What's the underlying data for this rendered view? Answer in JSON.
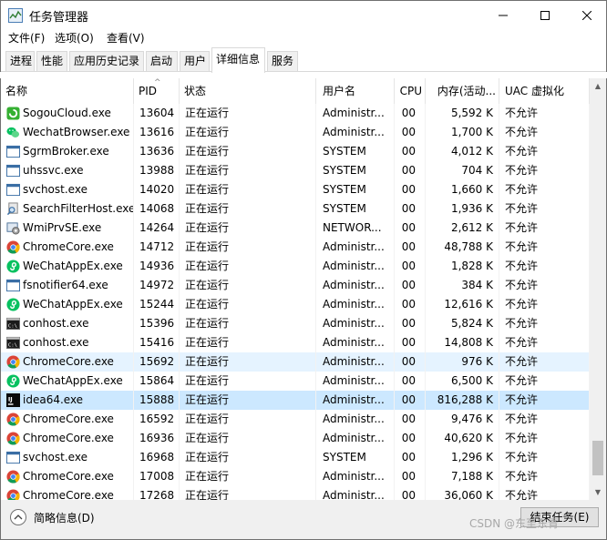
{
  "window": {
    "title": "任务管理器"
  },
  "menu": [
    "文件(F)",
    "选项(O)",
    "查看(V)"
  ],
  "tabs": [
    "进程",
    "性能",
    "应用历史记录",
    "启动",
    "用户",
    "详细信息",
    "服务"
  ],
  "active_tab": "详细信息",
  "columns": {
    "name": "名称",
    "pid": "PID",
    "status": "状态",
    "user": "用户名",
    "cpu": "CPU",
    "memory": "内存(活动...",
    "uac": "UAC 虚拟化"
  },
  "rows": [
    {
      "name": "SogouCloud.exe",
      "pid": "13604",
      "status": "正在运行",
      "user": "Administr...",
      "cpu": "00",
      "mem": "5,592 K",
      "uac": "不允许",
      "icon": "sogou-icon"
    },
    {
      "name": "WechatBrowser.exe",
      "pid": "13616",
      "status": "正在运行",
      "user": "Administr...",
      "cpu": "00",
      "mem": "1,700 K",
      "uac": "不允许",
      "icon": "wechat-icon"
    },
    {
      "name": "SgrmBroker.exe",
      "pid": "13636",
      "status": "正在运行",
      "user": "SYSTEM",
      "cpu": "00",
      "mem": "4,012 K",
      "uac": "不允许",
      "icon": "window-app-icon"
    },
    {
      "name": "uhssvc.exe",
      "pid": "13988",
      "status": "正在运行",
      "user": "SYSTEM",
      "cpu": "00",
      "mem": "704 K",
      "uac": "不允许",
      "icon": "window-app-icon"
    },
    {
      "name": "svchost.exe",
      "pid": "14020",
      "status": "正在运行",
      "user": "SYSTEM",
      "cpu": "00",
      "mem": "1,660 K",
      "uac": "不允许",
      "icon": "window-app-icon"
    },
    {
      "name": "SearchFilterHost.exe",
      "pid": "14068",
      "status": "正在运行",
      "user": "SYSTEM",
      "cpu": "00",
      "mem": "1,936 K",
      "uac": "不允许",
      "icon": "search-filter-icon"
    },
    {
      "name": "WmiPrvSE.exe",
      "pid": "14264",
      "status": "正在运行",
      "user": "NETWOR...",
      "cpu": "00",
      "mem": "2,612 K",
      "uac": "不允许",
      "icon": "wmi-icon"
    },
    {
      "name": "ChromeCore.exe",
      "pid": "14712",
      "status": "正在运行",
      "user": "Administr...",
      "cpu": "00",
      "mem": "48,788 K",
      "uac": "不允许",
      "icon": "chrome-icon"
    },
    {
      "name": "WeChatAppEx.exe",
      "pid": "14936",
      "status": "正在运行",
      "user": "Administr...",
      "cpu": "00",
      "mem": "1,828 K",
      "uac": "不允许",
      "icon": "wechat-app-icon"
    },
    {
      "name": "fsnotifier64.exe",
      "pid": "14972",
      "status": "正在运行",
      "user": "Administr...",
      "cpu": "00",
      "mem": "384 K",
      "uac": "不允许",
      "icon": "window-app-icon"
    },
    {
      "name": "WeChatAppEx.exe",
      "pid": "15244",
      "status": "正在运行",
      "user": "Administr...",
      "cpu": "00",
      "mem": "12,616 K",
      "uac": "不允许",
      "icon": "wechat-app-icon"
    },
    {
      "name": "conhost.exe",
      "pid": "15396",
      "status": "正在运行",
      "user": "Administr...",
      "cpu": "00",
      "mem": "5,824 K",
      "uac": "不允许",
      "icon": "console-icon"
    },
    {
      "name": "conhost.exe",
      "pid": "15416",
      "status": "正在运行",
      "user": "Administr...",
      "cpu": "00",
      "mem": "14,808 K",
      "uac": "不允许",
      "icon": "console-icon"
    },
    {
      "name": "ChromeCore.exe",
      "pid": "15692",
      "status": "正在运行",
      "user": "Administr...",
      "cpu": "00",
      "mem": "976 K",
      "uac": "不允许",
      "icon": "chrome-icon",
      "state": "hover"
    },
    {
      "name": "WeChatAppEx.exe",
      "pid": "15864",
      "status": "正在运行",
      "user": "Administr...",
      "cpu": "00",
      "mem": "6,500 K",
      "uac": "不允许",
      "icon": "wechat-app-icon"
    },
    {
      "name": "idea64.exe",
      "pid": "15888",
      "status": "正在运行",
      "user": "Administr...",
      "cpu": "00",
      "mem": "816,288 K",
      "uac": "不允许",
      "icon": "idea-icon",
      "state": "selected"
    },
    {
      "name": "ChromeCore.exe",
      "pid": "16592",
      "status": "正在运行",
      "user": "Administr...",
      "cpu": "00",
      "mem": "9,476 K",
      "uac": "不允许",
      "icon": "chrome-icon"
    },
    {
      "name": "ChromeCore.exe",
      "pid": "16936",
      "status": "正在运行",
      "user": "Administr...",
      "cpu": "00",
      "mem": "40,620 K",
      "uac": "不允许",
      "icon": "chrome-icon"
    },
    {
      "name": "svchost.exe",
      "pid": "16968",
      "status": "正在运行",
      "user": "SYSTEM",
      "cpu": "00",
      "mem": "1,296 K",
      "uac": "不允许",
      "icon": "window-app-icon"
    },
    {
      "name": "ChromeCore.exe",
      "pid": "17008",
      "status": "正在运行",
      "user": "Administr...",
      "cpu": "00",
      "mem": "7,188 K",
      "uac": "不允许",
      "icon": "chrome-icon"
    },
    {
      "name": "ChromeCore.exe",
      "pid": "17268",
      "status": "正在运行",
      "user": "Administr...",
      "cpu": "00",
      "mem": "36,060 K",
      "uac": "不允许",
      "icon": "chrome-icon"
    }
  ],
  "footer": {
    "fewer_details": "简略信息(D)",
    "end_task": "结束任务(E)",
    "watermark": "CSDN @东至东青"
  },
  "colors": {
    "selected": "#cce8ff",
    "hover": "#e5f3ff",
    "chrome_red": "#db4437",
    "chrome_green": "#0f9d58",
    "chrome_yellow": "#f4b400",
    "chrome_blue": "#4285f4",
    "wechat_green": "#07c160",
    "sogou_green": "#35b032"
  }
}
